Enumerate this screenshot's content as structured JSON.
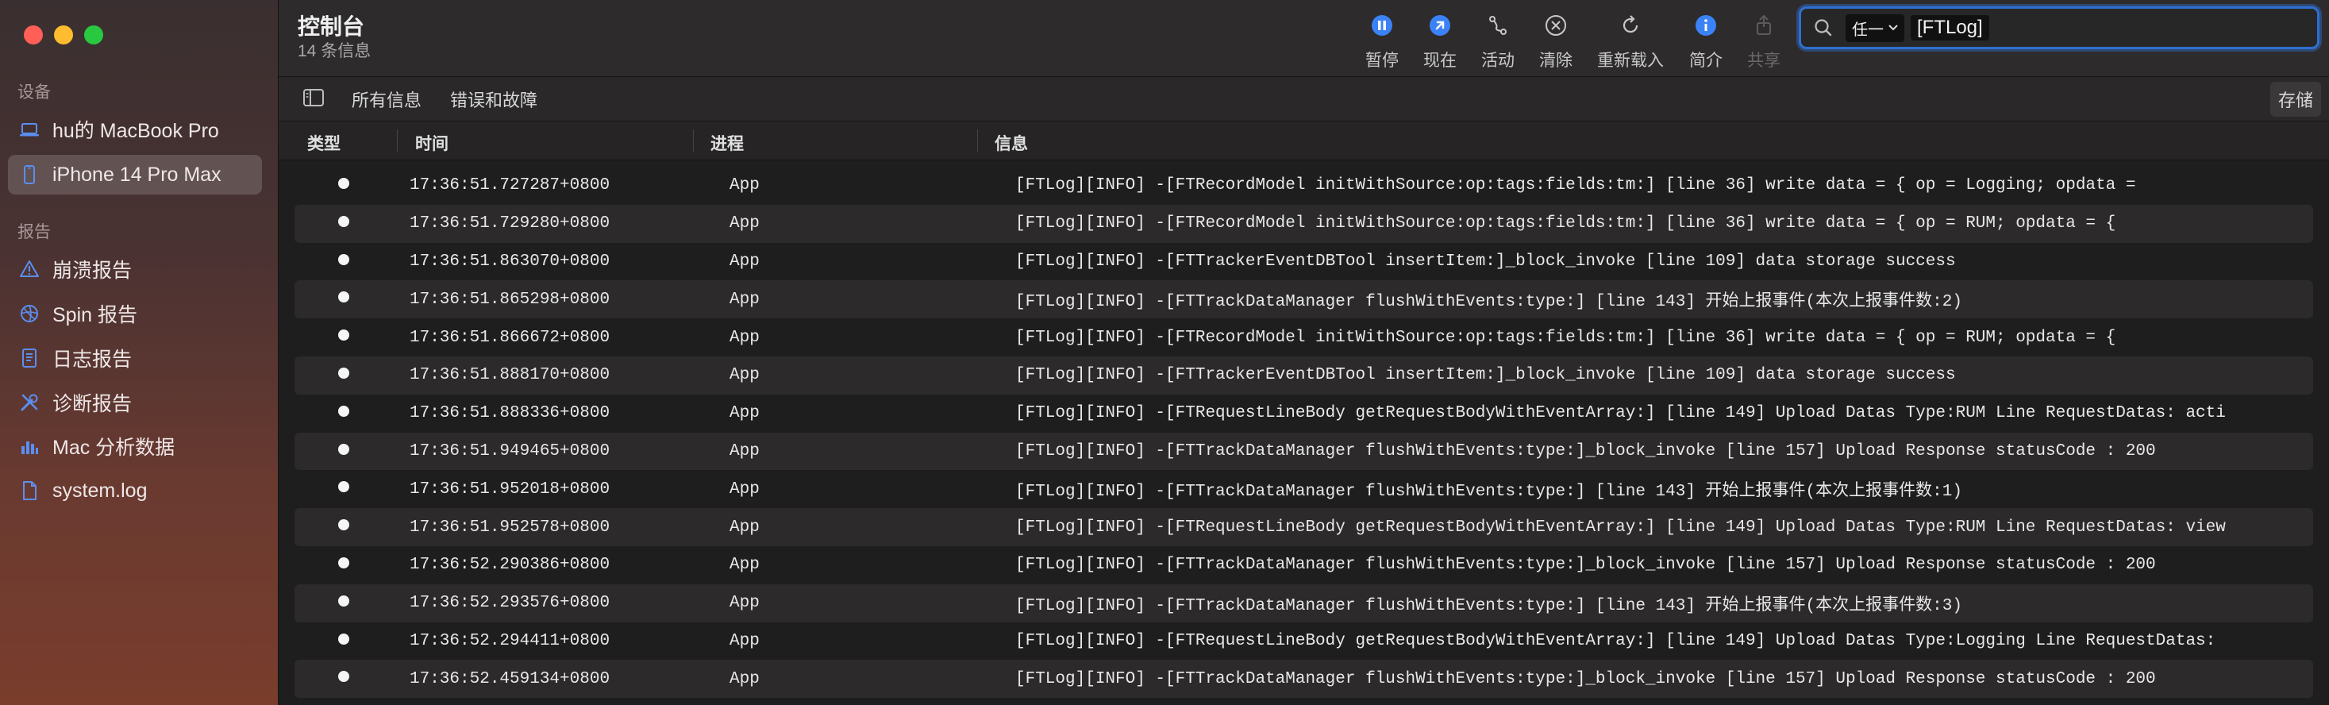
{
  "window": {
    "title": "控制台",
    "subtitle": "14 条信息"
  },
  "sidebar": {
    "devices_label": "设备",
    "devices": [
      {
        "label": "hu的 MacBook Pro",
        "icon": "laptop-icon"
      },
      {
        "label": "iPhone 14 Pro Max",
        "icon": "iphone-icon",
        "selected": true
      }
    ],
    "reports_label": "报告",
    "reports": [
      {
        "label": "崩溃报告",
        "icon": "warning-icon"
      },
      {
        "label": "Spin 报告",
        "icon": "spin-icon"
      },
      {
        "label": "日志报告",
        "icon": "log-doc-icon"
      },
      {
        "label": "诊断报告",
        "icon": "tools-icon"
      },
      {
        "label": "Mac 分析数据",
        "icon": "chart-icon"
      },
      {
        "label": "system.log",
        "icon": "file-icon"
      }
    ]
  },
  "toolbar": {
    "buttons": [
      {
        "label": "暂停",
        "icon": "pause-icon",
        "disabled": false
      },
      {
        "label": "现在",
        "icon": "now-icon",
        "disabled": false
      },
      {
        "label": "活动",
        "icon": "activity-icon",
        "disabled": false
      },
      {
        "label": "清除",
        "icon": "clear-icon",
        "disabled": false
      },
      {
        "label": "重新载入",
        "icon": "reload-icon",
        "disabled": false
      },
      {
        "label": "简介",
        "icon": "info-icon",
        "disabled": false
      },
      {
        "label": "共享",
        "icon": "share-icon",
        "disabled": true
      }
    ],
    "search": {
      "token": "任一",
      "value": "[FTLog]"
    }
  },
  "filterbar": {
    "tabs": [
      "所有信息",
      "错误和故障"
    ],
    "save_label": "存储"
  },
  "table": {
    "columns": [
      "类型",
      "时间",
      "进程",
      "信息"
    ],
    "rows": [
      {
        "time": "17:36:51.727287+0800",
        "process": "App",
        "message": "[FTLog][INFO] -[FTRecordModel initWithSource:op:tags:fields:tm:] [line 36] write data = {     op = Logging;     opdata = "
      },
      {
        "time": "17:36:51.729280+0800",
        "process": "App",
        "message": "[FTLog][INFO] -[FTRecordModel initWithSource:op:tags:fields:tm:] [line 36] write data = {     op = RUM;     opdata =     {"
      },
      {
        "time": "17:36:51.863070+0800",
        "process": "App",
        "message": "[FTLog][INFO] -[FTTrackerEventDBTool insertItem:]_block_invoke [line 109] data storage success"
      },
      {
        "time": "17:36:51.865298+0800",
        "process": "App",
        "message": "[FTLog][INFO] -[FTTrackDataManager flushWithEvents:type:] [line 143] 开始上报事件(本次上报事件数:2)"
      },
      {
        "time": "17:36:51.866672+0800",
        "process": "App",
        "message": "[FTLog][INFO] -[FTRecordModel initWithSource:op:tags:fields:tm:] [line 36] write data = {     op = RUM;     opdata =     {"
      },
      {
        "time": "17:36:51.888170+0800",
        "process": "App",
        "message": "[FTLog][INFO] -[FTTrackerEventDBTool insertItem:]_block_invoke [line 109] data storage success"
      },
      {
        "time": "17:36:51.888336+0800",
        "process": "App",
        "message": "[FTLog][INFO] -[FTRequestLineBody getRequestBodyWithEventArray:] [line 149]  Upload Datas Type:RUM Line RequestDatas: acti"
      },
      {
        "time": "17:36:51.949465+0800",
        "process": "App",
        "message": "[FTLog][INFO] -[FTTrackDataManager flushWithEvents:type:]_block_invoke [line 157] Upload Response statusCode : 200"
      },
      {
        "time": "17:36:51.952018+0800",
        "process": "App",
        "message": "[FTLog][INFO] -[FTTrackDataManager flushWithEvents:type:] [line 143] 开始上报事件(本次上报事件数:1)"
      },
      {
        "time": "17:36:51.952578+0800",
        "process": "App",
        "message": "[FTLog][INFO] -[FTRequestLineBody getRequestBodyWithEventArray:] [line 149]  Upload Datas Type:RUM Line RequestDatas: view"
      },
      {
        "time": "17:36:52.290386+0800",
        "process": "App",
        "message": "[FTLog][INFO] -[FTTrackDataManager flushWithEvents:type:]_block_invoke [line 157] Upload Response statusCode : 200"
      },
      {
        "time": "17:36:52.293576+0800",
        "process": "App",
        "message": "[FTLog][INFO] -[FTTrackDataManager flushWithEvents:type:] [line 143] 开始上报事件(本次上报事件数:3)"
      },
      {
        "time": "17:36:52.294411+0800",
        "process": "App",
        "message": "[FTLog][INFO] -[FTRequestLineBody getRequestBodyWithEventArray:] [line 149]  Upload Datas Type:Logging Line RequestDatas:"
      },
      {
        "time": "17:36:52.459134+0800",
        "process": "App",
        "message": "[FTLog][INFO] -[FTTrackDataManager flushWithEvents:type:]_block_invoke [line 157] Upload Response statusCode : 200"
      }
    ]
  },
  "colors": {
    "accent": "#2f6fd1",
    "toolbar_icon": "#3b82f6"
  }
}
